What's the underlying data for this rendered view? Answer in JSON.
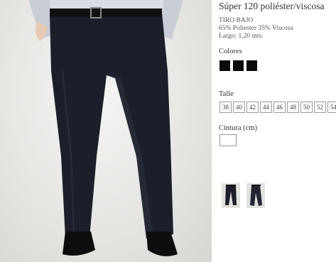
{
  "product": {
    "title": "Súper 120 poliéster/viscosa",
    "subtitle": "TIRO BAJO",
    "composition": "65% Poliester 35% Viscosa",
    "length": "Largo: 1,20 mts."
  },
  "colors": {
    "label": "Colores",
    "swatches": [
      "#0a0a0a",
      "#0a0a0a",
      "#0a0a0a"
    ]
  },
  "sizes": {
    "label": "Talle",
    "options": [
      "38",
      "40",
      "42",
      "44",
      "46",
      "48",
      "50",
      "52",
      "54"
    ]
  },
  "waist": {
    "label": "Cintura (cm)",
    "value": ""
  },
  "thumbnails": [
    "product-thumbnail-1",
    "product-thumbnail-2"
  ]
}
